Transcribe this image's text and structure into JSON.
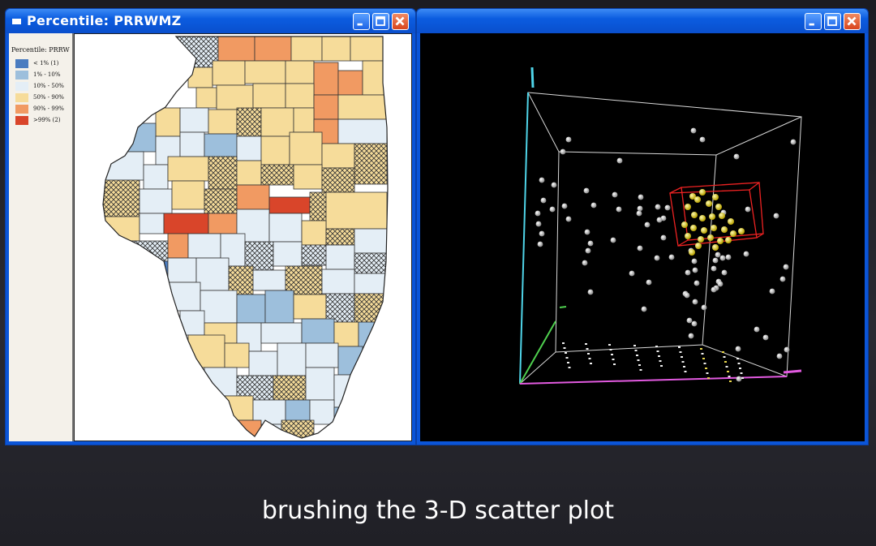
{
  "left_window": {
    "title": "Percentile: PRRWMZ",
    "legend_title": "Percentile: PRRW",
    "legend_items": [
      {
        "label": "< 1% (1)",
        "color": "#4a7cc0"
      },
      {
        "label": "1% - 10%",
        "color": "#9dbfdc"
      },
      {
        "label": "10% - 50%",
        "color": "#e4eef6"
      },
      {
        "label": "50% - 90%",
        "color": "#f6dc9a"
      },
      {
        "label": "90% - 99%",
        "color": "#f19a62"
      },
      {
        "label": ">99% (2)",
        "color": "#d9452a"
      }
    ],
    "controls": [
      "minimize-icon",
      "maximize-icon",
      "close-icon"
    ]
  },
  "right_window": {
    "title": "",
    "controls": [
      "minimize-icon",
      "maximize-icon",
      "close-icon"
    ],
    "plot_type": "3-D scatter plot"
  },
  "caption": "brushing the 3-D scatter plot"
}
